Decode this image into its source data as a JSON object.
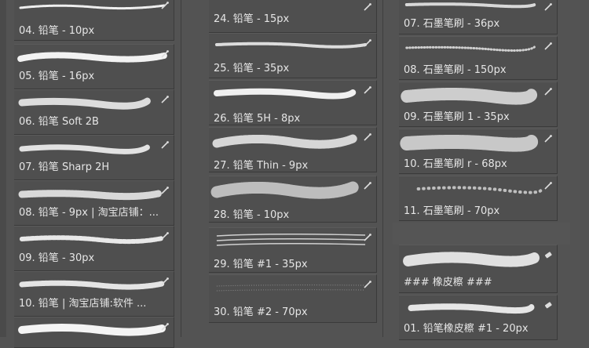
{
  "brush_panel": {
    "column1": [
      {
        "label": "04. 铅笔 - 10px"
      },
      {
        "label": "05. 铅笔 - 16px"
      },
      {
        "label": "06. 铅笔 Soft 2B"
      },
      {
        "label": "07. 铅笔  Sharp 2H"
      },
      {
        "label": "08. 铅笔 - 9px | 淘宝店铺：..."
      },
      {
        "label": "09. 铅笔 - 30px"
      },
      {
        "label": "10. 铅笔 | 淘宝店铺:软件 ..."
      }
    ],
    "column2": [
      {
        "label": "24. 铅笔  - 15px"
      },
      {
        "label": "25. 铅笔 - 35px"
      },
      {
        "label": "26. 铅笔  5H - 8px"
      },
      {
        "label": "27. 铅笔  Thin - 9px"
      },
      {
        "label": "28. 铅笔 - 10px"
      },
      {
        "label": "29. 铅笔  #1 - 35px"
      },
      {
        "label": "30. 铅笔 #2 - 70px"
      }
    ],
    "column3": [
      {
        "label": "07. 石墨笔刷 - 36px"
      },
      {
        "label": "08. 石墨笔刷 - 150px"
      },
      {
        "label": "09. 石墨笔刷  1 - 35px"
      },
      {
        "label": "10. 石墨笔刷 r - 68px"
      },
      {
        "label": "11. 石墨笔刷 - 70px"
      },
      {
        "label": "### 橡皮檫 ###"
      },
      {
        "label": "01. 铅笔橡皮檫  #1 - 20px"
      }
    ]
  },
  "icons": {
    "brush_tool": "brush-icon",
    "eraser_tool": "eraser-icon"
  },
  "colors": {
    "panel_bg": "#535353",
    "preset_bg": "#4f4f4f",
    "label_text": "#e6e6e6",
    "stroke": "#f0f0f0"
  }
}
